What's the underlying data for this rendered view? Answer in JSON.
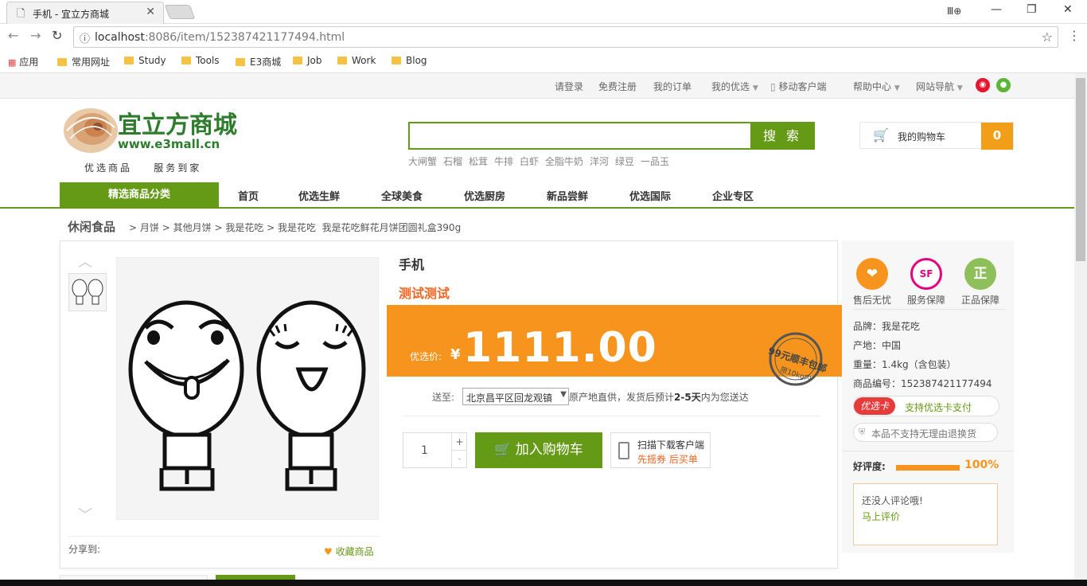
{
  "browser": {
    "tab_title": "手机 - 宜立方商城",
    "url_host": "localhost",
    "url_rest": ":8086/item/152387421177494.html"
  },
  "bookmarks": [
    "应用",
    "常用网址",
    "Study",
    "Tools",
    "E3商城",
    "Job",
    "Work",
    "Blog"
  ],
  "topbar": {
    "links": [
      "请登录",
      "免费注册",
      "我的订单",
      "我的优选",
      "移动客户端",
      "帮助中心",
      "网站导航"
    ]
  },
  "header": {
    "logo_title": "宜立方商城",
    "logo_url": "www.e3mall.cn",
    "logo_slogan": "优选商品    服务到家",
    "search_button": "搜 索",
    "search_value": "",
    "hot_words": [
      "大闸蟹",
      "石榴",
      "松茸",
      "牛排",
      "白虾",
      "全脂牛奶",
      "洋河",
      "绿豆",
      "一品玉"
    ],
    "cart_label": "我的购物车",
    "cart_count": "0"
  },
  "nav": {
    "category_label": "精选商品分类",
    "items": [
      "首页",
      "优选生鲜",
      "全球美食",
      "优选厨房",
      "新品尝鲜",
      "优选国际",
      "企业专区"
    ]
  },
  "breadcrumb": {
    "root": "休闲食品",
    "parts": [
      "月饼",
      "其他月饼",
      "我是花吃",
      "我是花吃  我是花吃鲜花月饼团圆礼盒390g"
    ]
  },
  "product": {
    "name": "手机",
    "subtitle": "测试测试",
    "price_label": "优选价:",
    "currency": "¥",
    "price": "1111.00",
    "stamp_text": "99元顺丰包邮",
    "stamp_sub": "限10kg内",
    "ship_label": "送至:",
    "ship_location": "北京昌平区回龙观镇",
    "ship_note_prefix": "原产地直供，发货后预计",
    "ship_days": "2-5天",
    "ship_note_suffix": "内为您送达",
    "quantity": "1",
    "plus": "+",
    "minus": "-",
    "add_to_cart": "加入购物车",
    "scan_line1": "扫描下载客户端",
    "scan_line2": "先摇券 后买单",
    "share_label": "分享到:",
    "favorite": "收藏商品"
  },
  "side": {
    "badges": [
      {
        "label": "售后无忧",
        "glyph": "❤",
        "color": "#f7941d"
      },
      {
        "label": "服务保障",
        "glyph": "SF",
        "color": "#e4007f"
      },
      {
        "label": "正品保障",
        "glyph": "正",
        "color": "#8fbf5a"
      }
    ],
    "brand": "品牌：我是花吃",
    "origin": "产地：中国",
    "weight": "重量：1.4kg（含包装）",
    "sku": "商品编号：152387421177494",
    "card_label": "优选卡",
    "card_text": "支持优选卡支付",
    "return_text": "本品不支持无理由退换货",
    "rating_label": "好评度:",
    "rating_pct": "100%",
    "rating_value": 100,
    "no_review": "还没人评论哦!",
    "review_now": "马上评价"
  },
  "colors": {
    "green": "#659a16",
    "orange": "#f7941d",
    "red": "#e63a3b"
  }
}
